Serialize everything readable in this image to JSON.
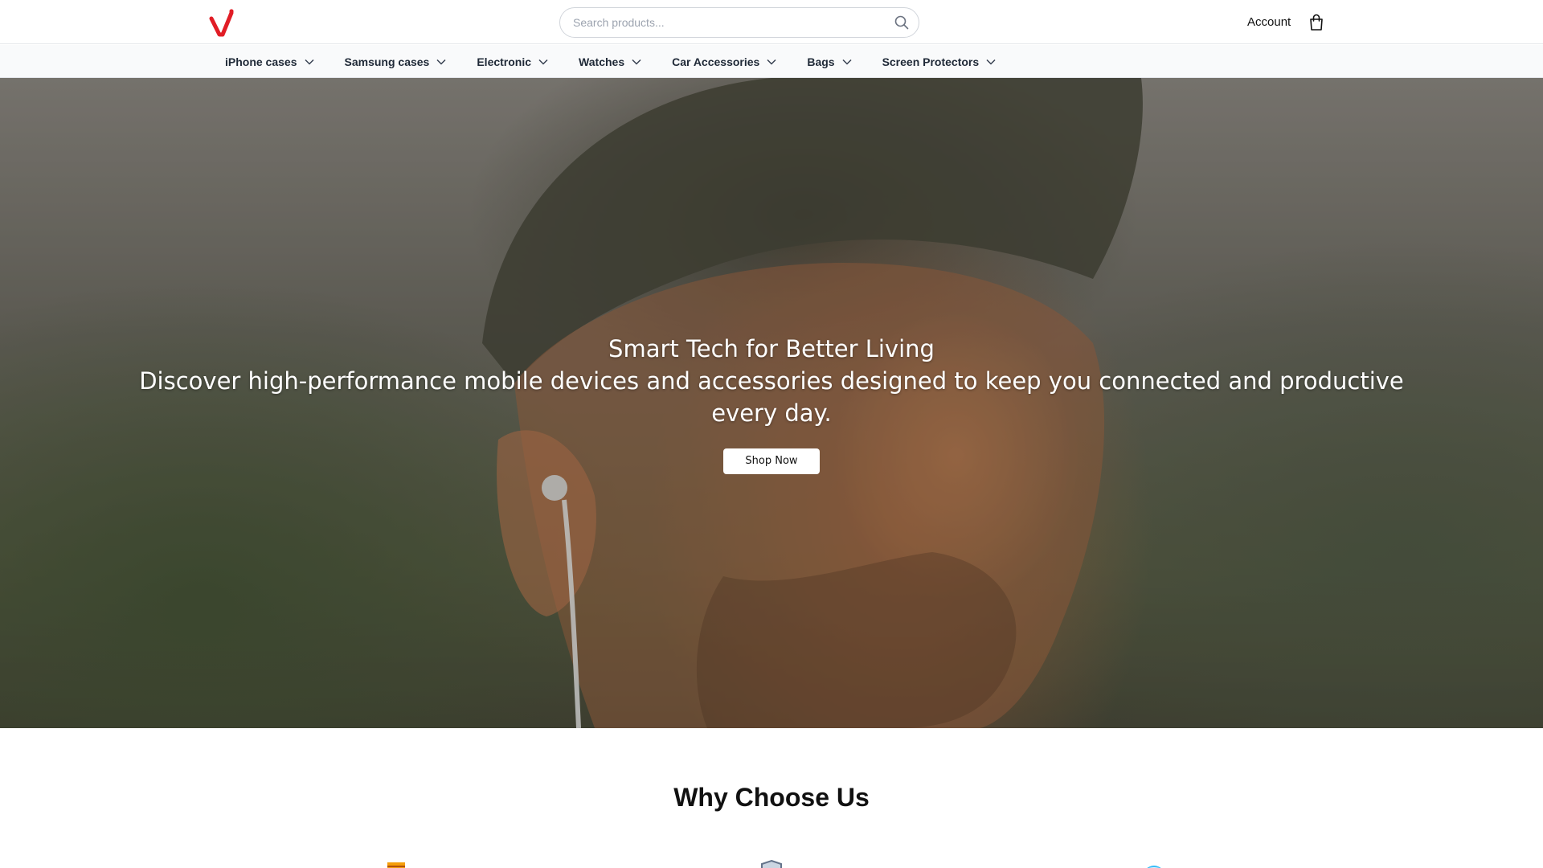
{
  "header": {
    "logo_text": "V",
    "search_placeholder": "Search products...",
    "account_label": "Account"
  },
  "nav": {
    "items": [
      {
        "label": "iPhone cases"
      },
      {
        "label": "Samsung cases"
      },
      {
        "label": "Electronic"
      },
      {
        "label": "Watches"
      },
      {
        "label": "Car Accessories"
      },
      {
        "label": "Bags"
      },
      {
        "label": "Screen Protectors"
      }
    ]
  },
  "hero": {
    "title": "Smart Tech for Better Living",
    "subtitle": "Discover high-performance mobile devices and accessories designed to keep you connected and productive every day.",
    "cta_label": "Shop Now"
  },
  "why": {
    "title": "Why Choose Us",
    "feature_icons": [
      "delivery-icon",
      "shield-icon",
      "globe-icon"
    ]
  },
  "colors": {
    "brand": "#e11d26",
    "nav_bg": "#f9fafb",
    "text": "#111111"
  }
}
